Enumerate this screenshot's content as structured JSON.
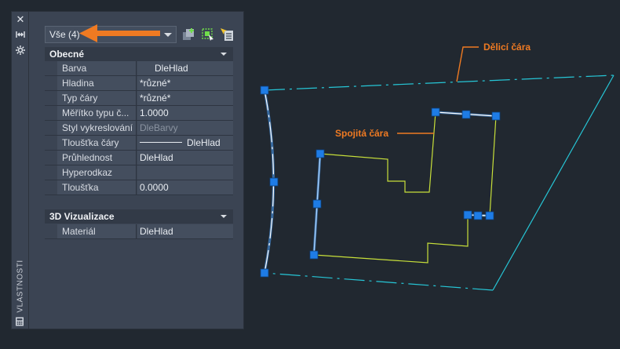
{
  "palette": {
    "title": "VLASTNOSTI",
    "close_glyph": "✕",
    "selection": {
      "value": "Vše (4)"
    },
    "sections": [
      {
        "title": "Obecné",
        "rows": [
          {
            "name": "Barva",
            "value": "DleHlad"
          },
          {
            "name": "Hladina",
            "value": "*různé*"
          },
          {
            "name": "Typ čáry",
            "value": "*různé*"
          },
          {
            "name": "Měřítko typu č...",
            "value": "1.0000"
          },
          {
            "name": "Styl vykreslování",
            "value": "DleBarvy"
          },
          {
            "name": "Tloušťka čáry",
            "value": "DleHlad"
          },
          {
            "name": "Průhlednost",
            "value": "DleHlad"
          },
          {
            "name": "Hyperodkaz",
            "value": ""
          },
          {
            "name": "Tloušťka",
            "value": "0.0000"
          }
        ]
      },
      {
        "title": "3D Vizualizace",
        "rows": [
          {
            "name": "Materiál",
            "value": "DleHlad"
          }
        ]
      }
    ]
  },
  "annotations": {
    "dividing_line": "Dělicí čára",
    "polyline": "Spojitá čára"
  },
  "colors": {
    "background": "#212830",
    "panel": "#3b4453",
    "accent_arrow": "#ef7a22",
    "dividing_line": "#26c6d6",
    "polyline": "#c8e03a",
    "grip": "#1e7ce6"
  },
  "icons": [
    "close-icon",
    "autohide-icon",
    "settings-icon",
    "calculator-icon",
    "toggle-pickadd-icon",
    "select-objects-icon",
    "quick-select-icon"
  ]
}
